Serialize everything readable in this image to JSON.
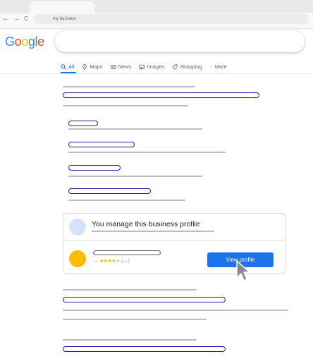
{
  "browser": {
    "back_glyph": "←",
    "forward_glyph": "→",
    "reload_glyph": "C",
    "address": "my business"
  },
  "search": {
    "logo_letters": [
      {
        "ch": "G",
        "color": "#4285F4"
      },
      {
        "ch": "o",
        "color": "#EA4335"
      },
      {
        "ch": "o",
        "color": "#FBBC05"
      },
      {
        "ch": "g",
        "color": "#4285F4"
      },
      {
        "ch": "l",
        "color": "#34A853"
      },
      {
        "ch": "e",
        "color": "#EA4335"
      }
    ],
    "query": "",
    "tabs": [
      {
        "label": "All",
        "icon": "search-icon",
        "active": true
      },
      {
        "label": "Maps",
        "icon": "map-pin-icon",
        "active": false
      },
      {
        "label": "News",
        "icon": "news-icon",
        "active": false
      },
      {
        "label": "Images",
        "icon": "image-icon",
        "active": false
      },
      {
        "label": "Shopping",
        "icon": "tag-icon",
        "active": false
      },
      {
        "label": "More",
        "icon": "more-dots-icon",
        "active": false
      }
    ]
  },
  "business_card": {
    "title": "You manage this business profile",
    "rating_prefix": "—",
    "rating_stars": "★★★★",
    "rating_empty": "★",
    "rating_count": "(—)",
    "stars_value": 4,
    "stars_max": 5,
    "button_label": "View profile"
  },
  "colors": {
    "accent": "#1a73e8",
    "link_outline": "#1f1fa3",
    "placeholder_gray": "#bdbdbd",
    "avatar_yellow": "#fbbc04",
    "avatar_light": "#d6e2fb"
  }
}
